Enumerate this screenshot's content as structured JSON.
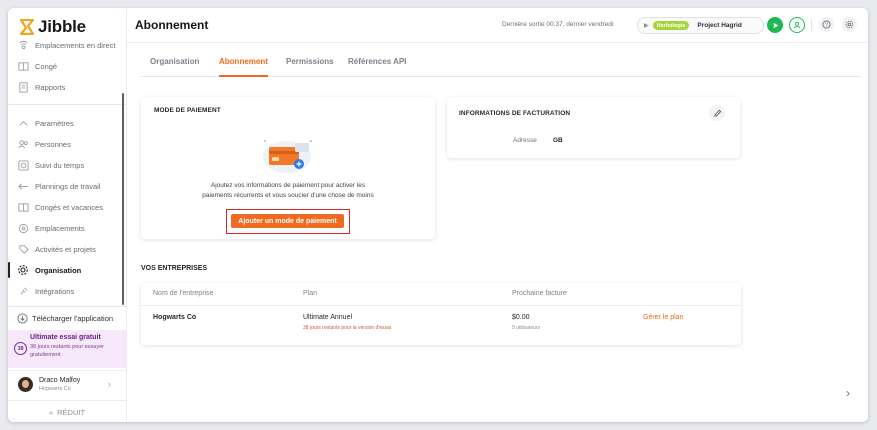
{
  "app": {
    "logo_text": "Jibble"
  },
  "sidebar": {
    "items": [
      {
        "label": "Emplacements en direct",
        "icon": "live-location-icon"
      },
      {
        "label": "Congé",
        "icon": "leave-icon"
      },
      {
        "label": "Rapports",
        "icon": "reports-icon"
      },
      {
        "label": "Paramètres",
        "icon": "settings-chevron-icon"
      },
      {
        "label": "Personnes",
        "icon": "people-icon"
      },
      {
        "label": "Suivi du temps",
        "icon": "time-tracking-icon"
      },
      {
        "label": "Plannings de travail",
        "icon": "work-schedule-icon"
      },
      {
        "label": "Congés et vacances",
        "icon": "holidays-icon"
      },
      {
        "label": "Emplacements",
        "icon": "location-icon"
      },
      {
        "label": "Activités et projets",
        "icon": "activities-icon"
      },
      {
        "label": "Organisation",
        "icon": "organisation-gear-icon",
        "active": true
      },
      {
        "label": "Intégrations",
        "icon": "integrations-icon"
      }
    ],
    "download_label": "Télécharger l'application",
    "trial": {
      "badge": "38",
      "title": "Ultimate essai gratuit",
      "subtitle": "38 jours restants pour essayer gratuitement"
    },
    "user": {
      "name": "Draco Malfoy",
      "company": "Hogwarts Co"
    },
    "reduce_label": "RÉDUIT"
  },
  "topbar": {
    "title": "Abonnement",
    "last_out": "Dernière sortie 00:37, dernier vendredi",
    "activity_tag": "Herbologie",
    "project": "Project Hagrid",
    "colors": {
      "accent": "#ef6a1e",
      "play": "#1fb954",
      "tag": "#a7d43a"
    }
  },
  "tabs": [
    {
      "label": "Organisation"
    },
    {
      "label": "Abonnement",
      "active": true
    },
    {
      "label": "Permissions"
    },
    {
      "label": "Références API"
    }
  ],
  "payment": {
    "title": "MODE DE PAIEMENT",
    "text_line1": "Ajoutez vos informations de paiement pour activer les",
    "text_line2": "paiements récurrents et vous soucier d'une chose de moins",
    "button_label": "Ajouter un mode de paiement"
  },
  "billing": {
    "title": "INFORMATIONS DE FACTURATION",
    "address_label": "Adresse",
    "address_value": "GB"
  },
  "companies": {
    "title": "VOS ENTREPRISES",
    "columns": [
      "Nom de l'entreprise",
      "Plan",
      "Prochaine facture"
    ],
    "rows": [
      {
        "name": "Hogwarts Co",
        "plan": "Ultimate Annuel",
        "plan_sub": "38 jours restants pour la version d'essai",
        "invoice": "$0.00",
        "invoice_sub": "9 utilisateurs",
        "action": "Gérer le plan"
      }
    ]
  }
}
